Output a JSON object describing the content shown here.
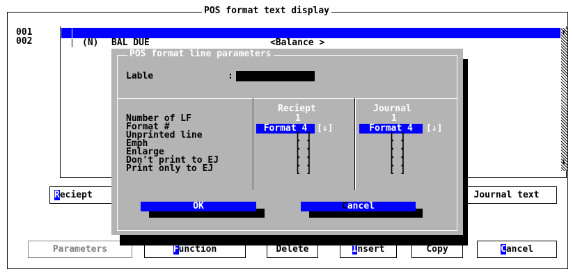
{
  "window": {
    "title": "POS format text display"
  },
  "list": {
    "line_numbers": [
      "001",
      "002"
    ],
    "row2": {
      "tag": "(N)",
      "name": "BAL DUE",
      "value": "<Balance >"
    },
    "scroll_up_glyph": "↑",
    "scroll_down_glyph": "↓"
  },
  "side_buttons": {
    "receipt_hot": "R",
    "receipt_rest": "eciept",
    "journal": "Journal text"
  },
  "dialog": {
    "title": "POS format line parameters",
    "label_caption": "Lable",
    "label_colon": ":",
    "label_value": "",
    "columns": {
      "receipt": "Reciept",
      "journal": "Journal"
    },
    "params": [
      "Number of LF",
      "Format #",
      "Unprinted line",
      "Emph",
      "Enlarge",
      "Don't print to EJ",
      "Print only to EJ"
    ],
    "receipt": {
      "lf": "1",
      "format": "Format 4",
      "format_arrow": "[↓]",
      "checks": [
        "[ ]",
        "[ ]",
        "[ ]",
        "[ ]",
        "[ ]"
      ]
    },
    "journal": {
      "lf": "1",
      "format": "Format 4",
      "format_arrow": "[↓]",
      "checks": [
        "[ ]",
        "[ ]",
        "[ ]",
        "[ ]",
        "[ ]"
      ]
    },
    "ok": "OK",
    "cancel_hot": "C",
    "cancel_rest": "ancel"
  },
  "bottom_buttons": {
    "parameters": "Parameters",
    "function_hot": "F",
    "function_rest": "unction",
    "delete": "Delete",
    "insert_hot": "I",
    "insert_rest": "nsert",
    "copy": "Copy",
    "cancel_hot": "C",
    "cancel_rest": "ancel"
  },
  "colors": {
    "accent": "#0000ff",
    "dialog_bg": "#b4b4b4",
    "disabled_text": "#808080"
  }
}
